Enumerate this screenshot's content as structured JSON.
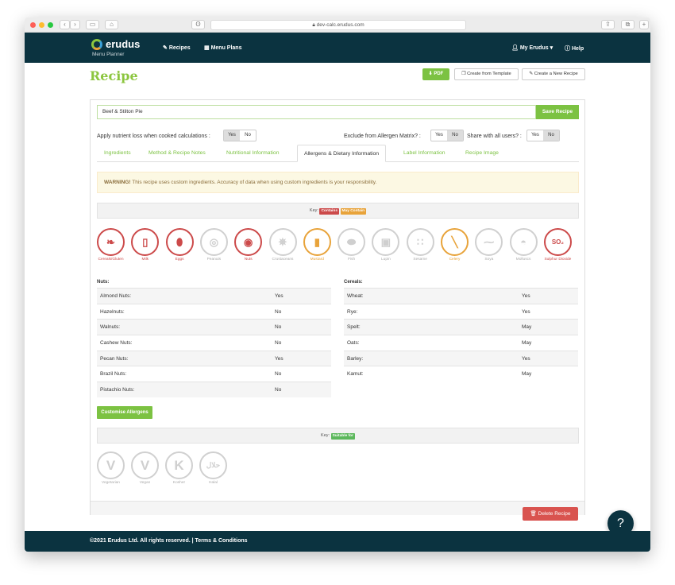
{
  "browser": {
    "url": "dev-calc.erudus.com"
  },
  "navbar": {
    "brand": "erudus",
    "subtitle": "Menu Planner",
    "recipes": "Recipes",
    "menu_plans": "Menu Plans",
    "account": "My Erudus",
    "help": "Help"
  },
  "page": {
    "title": "Recipe",
    "pdf": "PDF",
    "create_template": "Create from Template",
    "create_new": "Create a New Recipe"
  },
  "recipe": {
    "name": "Beef & Stilton Pie",
    "save": "Save Recipe"
  },
  "options": {
    "nutrient_loss_label": "Apply nutrient loss when cooked calculations :",
    "exclude_label": "Exclude from Allergen Matrix? :",
    "share_label": "Share with all users? :",
    "yes": "Yes",
    "no": "No"
  },
  "tabs": [
    "Ingredients",
    "Method & Recipe Notes",
    "Nutritional Information",
    "Allergens & Dietary Information",
    "Label Information",
    "Recipe Image"
  ],
  "warning": {
    "bold": "WARNING!",
    "text": "This recipe uses custom ingredients. Accuracy of data when using custom ingredients is your responsibility."
  },
  "key1": {
    "label": "Key:",
    "contains": "Contains",
    "may_contain": "May Contain"
  },
  "allergens": [
    {
      "name": "Cereals/Gluten",
      "status": "contains",
      "icon": "wheat-icon",
      "glyph": "❧"
    },
    {
      "name": "Milk",
      "status": "contains",
      "icon": "milk-icon",
      "glyph": "▯"
    },
    {
      "name": "Eggs",
      "status": "contains",
      "icon": "egg-icon",
      "glyph": "⬮"
    },
    {
      "name": "Peanuts",
      "status": "none",
      "icon": "peanut-icon",
      "glyph": "◎"
    },
    {
      "name": "Nuts",
      "status": "contains",
      "icon": "nut-icon",
      "glyph": "◉"
    },
    {
      "name": "Crustaceans",
      "status": "none",
      "icon": "crab-icon",
      "glyph": "✵"
    },
    {
      "name": "Mustard",
      "status": "may",
      "icon": "mustard-icon",
      "glyph": "▮"
    },
    {
      "name": "Fish",
      "status": "none",
      "icon": "fish-icon",
      "glyph": "⬬"
    },
    {
      "name": "Lupin",
      "status": "none",
      "icon": "lupin-icon",
      "glyph": "▣"
    },
    {
      "name": "Sesame",
      "status": "none",
      "icon": "sesame-icon",
      "glyph": "∷"
    },
    {
      "name": "Celery",
      "status": "may",
      "icon": "celery-icon",
      "glyph": "╲"
    },
    {
      "name": "Soya",
      "status": "none",
      "icon": "soya-icon",
      "glyph": "⁓"
    },
    {
      "name": "Molluscs",
      "status": "none",
      "icon": "mollusc-icon",
      "glyph": "◓"
    },
    {
      "name": "Sulphur Dioxide",
      "status": "contains",
      "icon": "sulphur-dioxide-icon",
      "glyph": "SO₂"
    }
  ],
  "nuts": {
    "label": "Nuts:",
    "rows": [
      {
        "k": "Almond Nuts:",
        "v": "Yes"
      },
      {
        "k": "Hazelnuts:",
        "v": "No"
      },
      {
        "k": "Walnuts:",
        "v": "No"
      },
      {
        "k": "Cashew Nuts:",
        "v": "No"
      },
      {
        "k": "Pecan Nuts:",
        "v": "Yes"
      },
      {
        "k": "Brazil Nuts:",
        "v": "No"
      },
      {
        "k": "Pistachio Nuts:",
        "v": "No"
      }
    ]
  },
  "cereals": {
    "label": "Cereals:",
    "rows": [
      {
        "k": "Wheat:",
        "v": "Yes"
      },
      {
        "k": "Rye:",
        "v": "Yes"
      },
      {
        "k": "Spelt:",
        "v": "May"
      },
      {
        "k": "Oats:",
        "v": "May"
      },
      {
        "k": "Barley:",
        "v": "Yes"
      },
      {
        "k": "Kamut:",
        "v": "May"
      }
    ]
  },
  "customise": "Customise Allergens",
  "key2": {
    "label": "Key:",
    "suitable": "Suitable for"
  },
  "diets": [
    {
      "name": "Vegetarian",
      "icon": "vegetarian-icon",
      "glyph": "V"
    },
    {
      "name": "Vegan",
      "icon": "vegan-icon",
      "glyph": "V"
    },
    {
      "name": "Kosher",
      "icon": "kosher-icon",
      "glyph": "K"
    },
    {
      "name": "Halal",
      "icon": "halal-icon",
      "glyph": "حلال"
    }
  ],
  "delete": "Delete Recipe",
  "help_fab": "?",
  "footer": {
    "copyright": "©2021 Erudus Ltd. All rights reserved.",
    "sep": " | ",
    "terms": "Terms & Conditions"
  },
  "colors": {
    "brand_green": "#7cc242",
    "navy": "#0b3340",
    "contains": "#cc4a4a",
    "may_contain": "#e8a33a",
    "danger": "#d9534f"
  }
}
